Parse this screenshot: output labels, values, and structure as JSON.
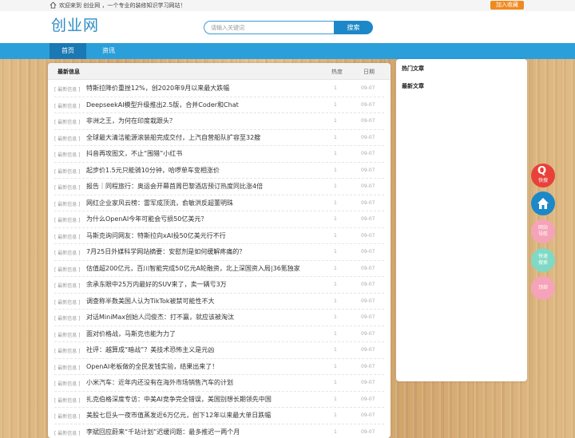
{
  "topbar": {
    "welcome": "欢迎来到 创业网 ，一个专业的装修知识学习网站！",
    "favorite": "加入收藏"
  },
  "header": {
    "logo": "创业网",
    "search_placeholder": "请输入关键词",
    "search_button": "搜索"
  },
  "nav": {
    "items": [
      "首页",
      "资讯"
    ],
    "active_color": "#1a78b4",
    "bar_color": "#2b9fd9"
  },
  "main": {
    "title": "最新信息",
    "col_hot": "热度",
    "col_date": "日期",
    "rows": [
      {
        "cat": "[ 最新信息 ]",
        "title": "特斯拉降价重挫12%，创2020年9月以来最大跌幅",
        "hot": "1",
        "date": "09-07"
      },
      {
        "cat": "[ 最新信息 ]",
        "title": "DeepseekAI模型升级推出2.5版，合并Coder和Chat",
        "hot": "1",
        "date": "09-07"
      },
      {
        "cat": "[ 最新信息 ]",
        "title": "非洲之王，为何在印度栽跟头？",
        "hot": "1",
        "date": "09-07"
      },
      {
        "cat": "[ 最新信息 ]",
        "title": "全球最大清洁能源滚装船完成交付，上汽自营船队扩容至32艘",
        "hot": "1",
        "date": "09-07"
      },
      {
        "cat": "[ 最新信息 ]",
        "title": "抖音再攻图文，不止“围猎”小红书",
        "hot": "1",
        "date": "09-07"
      },
      {
        "cat": "[ 最新信息 ]",
        "title": "起步价1.5元只能骑10分钟，哈啰单车变相涨价",
        "hot": "1",
        "date": "09-07"
      },
      {
        "cat": "[ 最新信息 ]",
        "title": "报告｜同程旅行：奥运会开幕首周巴黎酒店预订热度同比涨4倍",
        "hot": "1",
        "date": "09-07"
      },
      {
        "cat": "[ 最新信息 ]",
        "title": "网红企业家风云榜：雷军成顶流，俞敏洪反超董明珠",
        "hot": "1",
        "date": "09-07"
      },
      {
        "cat": "[ 最新信息 ]",
        "title": "为什么OpenAI今年可能会亏损50亿美元？",
        "hot": "1",
        "date": "09-07"
      },
      {
        "cat": "[ 最新信息 ]",
        "title": "马斯克询问网友：特斯拉向xAI投50亿美元行不行",
        "hot": "1",
        "date": "09-07"
      },
      {
        "cat": "[ 最新信息 ]",
        "title": "7月25日外媒科学网站摘要：安慰剂是如何缓解疼痛的？",
        "hot": "1",
        "date": "09-07"
      },
      {
        "cat": "[ 最新信息 ]",
        "title": "估值超200亿元，百川智能完成50亿元A轮融资，北上深国资入局|36氪独家",
        "hot": "1",
        "date": "09-07"
      },
      {
        "cat": "[ 最新信息 ]",
        "title": "余承东眼中25万内最好的SUV来了，卖一辆亏3万",
        "hot": "1",
        "date": "09-07"
      },
      {
        "cat": "[ 最新信息 ]",
        "title": "调查称半数美国人认为TikTok被禁可能性不大",
        "hot": "1",
        "date": "09-07"
      },
      {
        "cat": "[ 最新信息 ]",
        "title": "对话MiniMax创始人闫俊杰：打不赢，就应该被淘汰",
        "hot": "1",
        "date": "09-07"
      },
      {
        "cat": "[ 最新信息 ]",
        "title": "面对价格战，马斯克也能为力了",
        "hot": "1",
        "date": "09-07"
      },
      {
        "cat": "[ 最新信息 ]",
        "title": "社评：越算成“暗战”？美技术恐怖主义是元凶",
        "hot": "1",
        "date": "09-07"
      },
      {
        "cat": "[ 最新信息 ]",
        "title": "OpenAI老板做的全民发钱实验，结果出来了！",
        "hot": "1",
        "date": "09-07"
      },
      {
        "cat": "[ 最新信息 ]",
        "title": "小米汽车：近年内还没有在海外市场销售汽车的计划",
        "hot": "1",
        "date": "09-07"
      },
      {
        "cat": "[ 最新信息 ]",
        "title": "扎克伯格深度专访：中美AI竞争完全错误，美国别想长期领先中国",
        "hot": "1",
        "date": "09-07"
      },
      {
        "cat": "[ 最新信息 ]",
        "title": "美股七巨头一夜市值蒸发近6万亿元，创下12年以来最大单日跌幅",
        "hot": "1",
        "date": "09-07"
      },
      {
        "cat": "[ 最新信息 ]",
        "title": "李斌回应蔚来“千站计划”迟缓问题：最多推迟一两个月",
        "hot": "1",
        "date": "09-07"
      }
    ]
  },
  "sidebar": {
    "hot_articles": "热门文章",
    "latest_articles": "最新文章"
  },
  "float_buttons": {
    "search": "快搜",
    "site_nav": "网站导航",
    "quick_search": "快速搜索",
    "top": "顶部"
  }
}
